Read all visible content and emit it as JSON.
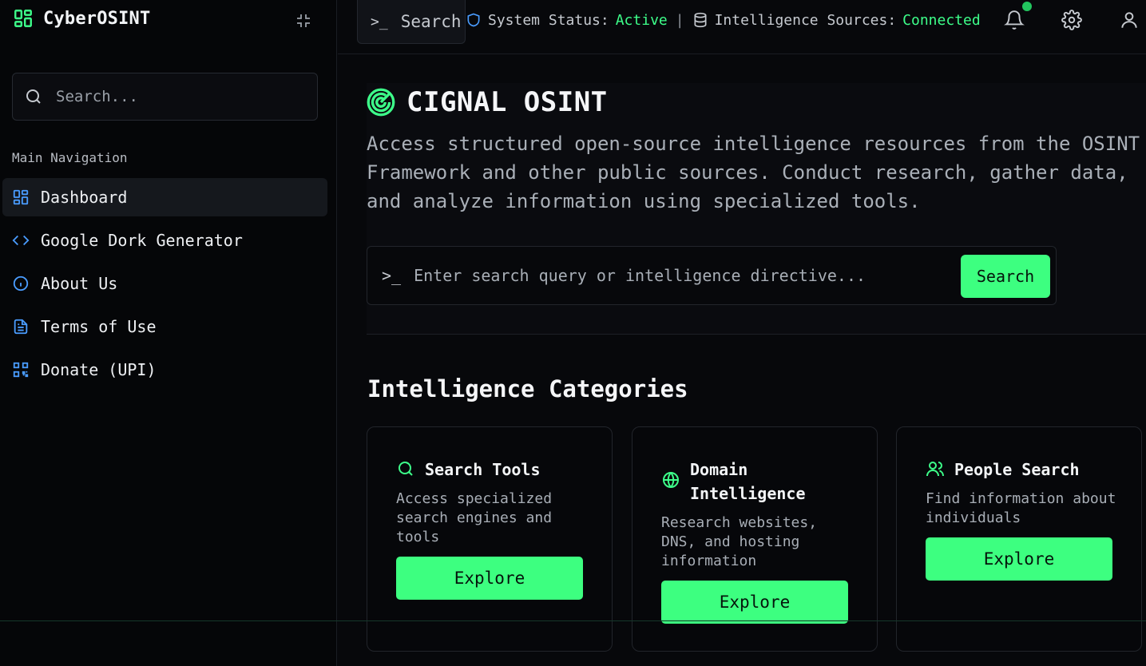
{
  "app": {
    "title": "CyberOSINT",
    "icons": {
      "brand": "dashboard-grid-icon",
      "collapse": "minimize-icon"
    }
  },
  "sidebar": {
    "search_placeholder": "Search...",
    "nav_heading": "Main Navigation",
    "items": [
      {
        "label": "Dashboard",
        "icon": "dashboard-icon",
        "active": true
      },
      {
        "label": "Google Dork Generator",
        "icon": "code-icon",
        "active": false
      },
      {
        "label": "About Us",
        "icon": "info-icon",
        "active": false
      },
      {
        "label": "Terms of Use",
        "icon": "document-icon",
        "active": false
      },
      {
        "label": "Donate (UPI)",
        "icon": "qr-code-icon",
        "active": false
      }
    ]
  },
  "topbar": {
    "search_label": "Search",
    "status_label": "System Status:",
    "status_value": "Active",
    "separator": "|",
    "sources_label": "Intelligence Sources:",
    "sources_value": "Connected",
    "icons": [
      "bell-icon",
      "settings-icon",
      "user-icon"
    ]
  },
  "hero": {
    "title": "CIGNAL OSINT",
    "description": "Access structured open-source intelligence resources from the OSINT Framework and other public sources. Conduct research, gather data, and analyze information using specialized tools.",
    "query_placeholder": "Enter search query or intelligence directive...",
    "search_button": "Search"
  },
  "categories": {
    "title": "Intelligence Categories",
    "cards": [
      {
        "title": "Search Tools",
        "description": "Access specialized search engines and tools",
        "button": "Explore",
        "icon": "search-icon"
      },
      {
        "title": "Domain Intelligence",
        "description": "Research websites, DNS, and hosting information",
        "button": "Explore",
        "icon": "globe-icon"
      },
      {
        "title": "People Search",
        "description": "Find information about individuals",
        "button": "Explore",
        "icon": "users-icon"
      }
    ]
  },
  "colors": {
    "accent": "#3dff80",
    "link_icon": "#4a9cff",
    "background": "#07080b"
  }
}
